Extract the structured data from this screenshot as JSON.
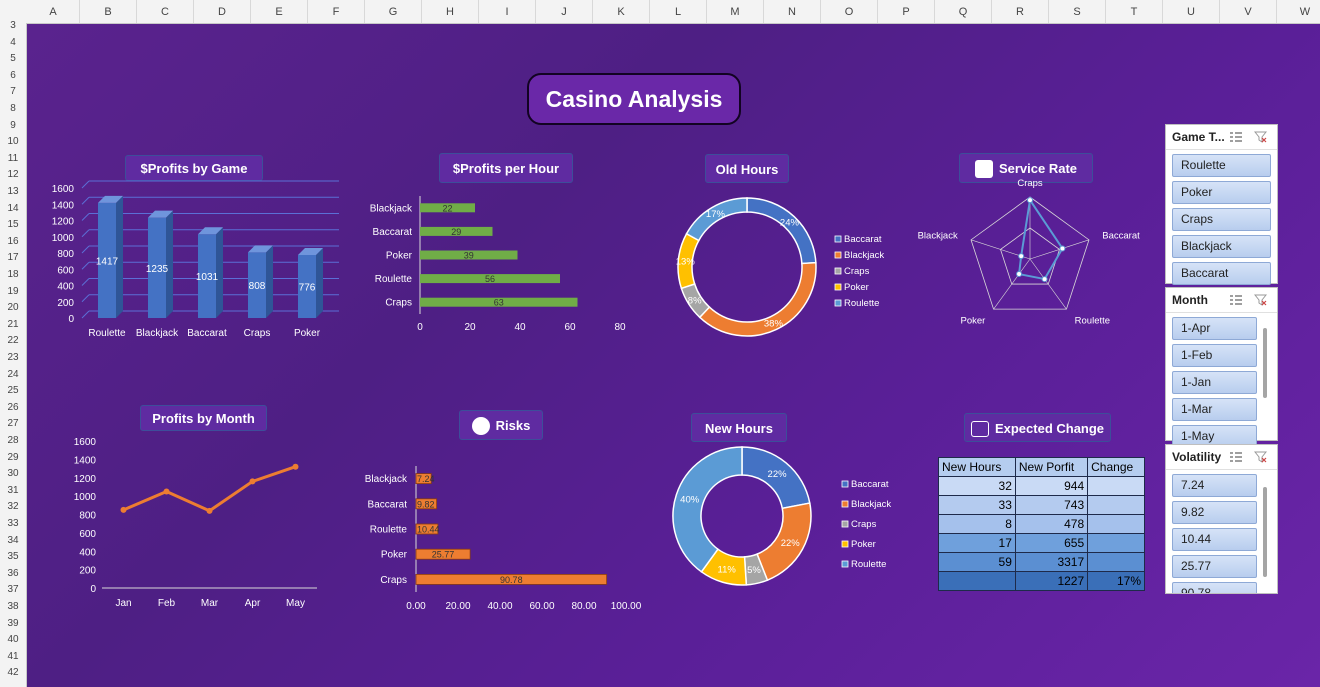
{
  "columns": [
    "A",
    "B",
    "C",
    "D",
    "E",
    "F",
    "G",
    "H",
    "I",
    "J",
    "K",
    "L",
    "M",
    "N",
    "O",
    "P",
    "Q",
    "R",
    "S",
    "T",
    "U",
    "V",
    "W"
  ],
  "rows": [
    "3",
    "4",
    "5",
    "6",
    "7",
    "8",
    "9",
    "10",
    "11",
    "12",
    "13",
    "14",
    "15",
    "16",
    "17",
    "18",
    "19",
    "20",
    "21",
    "22",
    "23",
    "24",
    "25",
    "26",
    "27",
    "28",
    "29",
    "30",
    "31",
    "32",
    "33",
    "34",
    "35",
    "36",
    "37",
    "38",
    "39",
    "40",
    "41",
    "42"
  ],
  "dashboard": {
    "title": "Casino Analysis",
    "titles": {
      "profits_by_game": "$Profits by Game",
      "profits_per_hour": "$Profits per Hour",
      "old_hours": "Old Hours",
      "service_rate": "Service Rate",
      "profits_by_month": "Profits by Month",
      "risks": "Risks",
      "new_hours": "New Hours",
      "expected_change": "Expected Change"
    }
  },
  "colors": {
    "bar_blue": "#4472c4",
    "bar_green": "#70ad47",
    "orange": "#ed7d31",
    "gray": "#a5a5a5",
    "gold": "#ffc000",
    "light_blue": "#5b9bd5",
    "purple_bg": "#5a238e"
  },
  "chart_data": [
    {
      "id": "profits_by_game",
      "type": "bar",
      "categories": [
        "Roulette",
        "Blackjack",
        "Baccarat",
        "Craps",
        "Poker"
      ],
      "values": [
        1417,
        1235,
        1031,
        808,
        776
      ],
      "yticks": [
        0,
        200,
        400,
        600,
        800,
        1000,
        1200,
        1400,
        1600
      ],
      "ylim": [
        0,
        1600
      ]
    },
    {
      "id": "profits_per_hour",
      "type": "bar",
      "orientation": "horizontal",
      "categories": [
        "Blackjack",
        "Baccarat",
        "Poker",
        "Roulette",
        "Craps"
      ],
      "values": [
        22,
        29,
        39,
        56,
        63
      ],
      "xticks": [
        0,
        20,
        40,
        60,
        80
      ],
      "xlim": [
        0,
        80
      ]
    },
    {
      "id": "old_hours",
      "type": "pie",
      "hole": true,
      "categories": [
        "Baccarat",
        "Blackjack",
        "Craps",
        "Poker",
        "Roulette"
      ],
      "values": [
        24,
        38,
        8,
        13,
        17
      ],
      "labels": [
        "24%",
        "38%",
        "8%",
        "13%",
        "17%"
      ]
    },
    {
      "id": "service_rate",
      "type": "radar",
      "categories": [
        "Craps",
        "Baccarat",
        "Roulette",
        "Poker",
        "Blackjack"
      ],
      "values": [
        0.95,
        0.55,
        0.4,
        0.3,
        0.15
      ]
    },
    {
      "id": "profits_by_month",
      "type": "line",
      "categories": [
        "Jan",
        "Feb",
        "Mar",
        "Apr",
        "May"
      ],
      "values": [
        850,
        1050,
        840,
        1160,
        1320
      ],
      "yticks": [
        0,
        200,
        400,
        600,
        800,
        1000,
        1200,
        1400,
        1600
      ],
      "ylim": [
        0,
        1600
      ]
    },
    {
      "id": "risks",
      "type": "bar",
      "orientation": "horizontal",
      "categories": [
        "Blackjack",
        "Baccarat",
        "Roulette",
        "Poker",
        "Craps"
      ],
      "values": [
        7.24,
        9.82,
        10.44,
        25.77,
        90.78
      ],
      "labels": [
        "7.24",
        "9.82",
        "10.44",
        "25.77",
        "90.78"
      ],
      "xticks": [
        "0.00",
        "20.00",
        "40.00",
        "60.00",
        "80.00",
        "100.00"
      ],
      "xlim": [
        0,
        100
      ]
    },
    {
      "id": "new_hours",
      "type": "pie",
      "hole": true,
      "categories": [
        "Baccarat",
        "Blackjack",
        "Craps",
        "Poker",
        "Roulette"
      ],
      "values": [
        22,
        22,
        5,
        11,
        40
      ],
      "labels": [
        "22%",
        "22%",
        "5%",
        "11%",
        "40%"
      ]
    },
    {
      "id": "expected_change",
      "type": "table",
      "headers": [
        "New Hours",
        "New Porfit",
        "Change"
      ],
      "rows": [
        [
          "32",
          "944",
          ""
        ],
        [
          "33",
          "743",
          ""
        ],
        [
          "8",
          "478",
          ""
        ],
        [
          "17",
          "655",
          ""
        ],
        [
          "59",
          "3317",
          ""
        ],
        [
          "",
          "1227",
          "17%"
        ]
      ]
    }
  ],
  "slicers": {
    "game_type": {
      "label": "Game T...",
      "items": [
        "Roulette",
        "Poker",
        "Craps",
        "Blackjack",
        "Baccarat"
      ]
    },
    "month": {
      "label": "Month",
      "items": [
        "1-Apr",
        "1-Feb",
        "1-Jan",
        "1-Mar",
        "1-May"
      ]
    },
    "volatility": {
      "label": "Volatility",
      "items": [
        "7.24",
        "9.82",
        "10.44",
        "25.77",
        "90.78"
      ]
    }
  }
}
